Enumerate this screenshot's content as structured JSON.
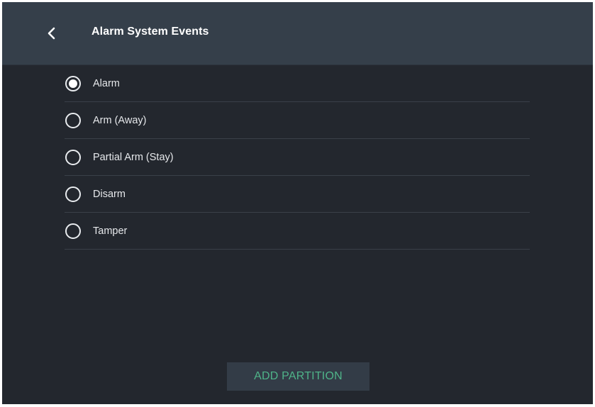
{
  "header": {
    "back_icon": "chevron-left-icon",
    "title": "Alarm System Events"
  },
  "options": [
    {
      "label": "Alarm",
      "selected": true
    },
    {
      "label": "Arm (Away)",
      "selected": false
    },
    {
      "label": "Partial Arm (Stay)",
      "selected": false
    },
    {
      "label": "Disarm",
      "selected": false
    },
    {
      "label": "Tamper",
      "selected": false
    }
  ],
  "footer": {
    "add_partition_label": "ADD PARTITION"
  },
  "colors": {
    "background": "#23272e",
    "header": "#353f4a",
    "accent_text": "#4fb489",
    "button_bg": "#333c47"
  }
}
